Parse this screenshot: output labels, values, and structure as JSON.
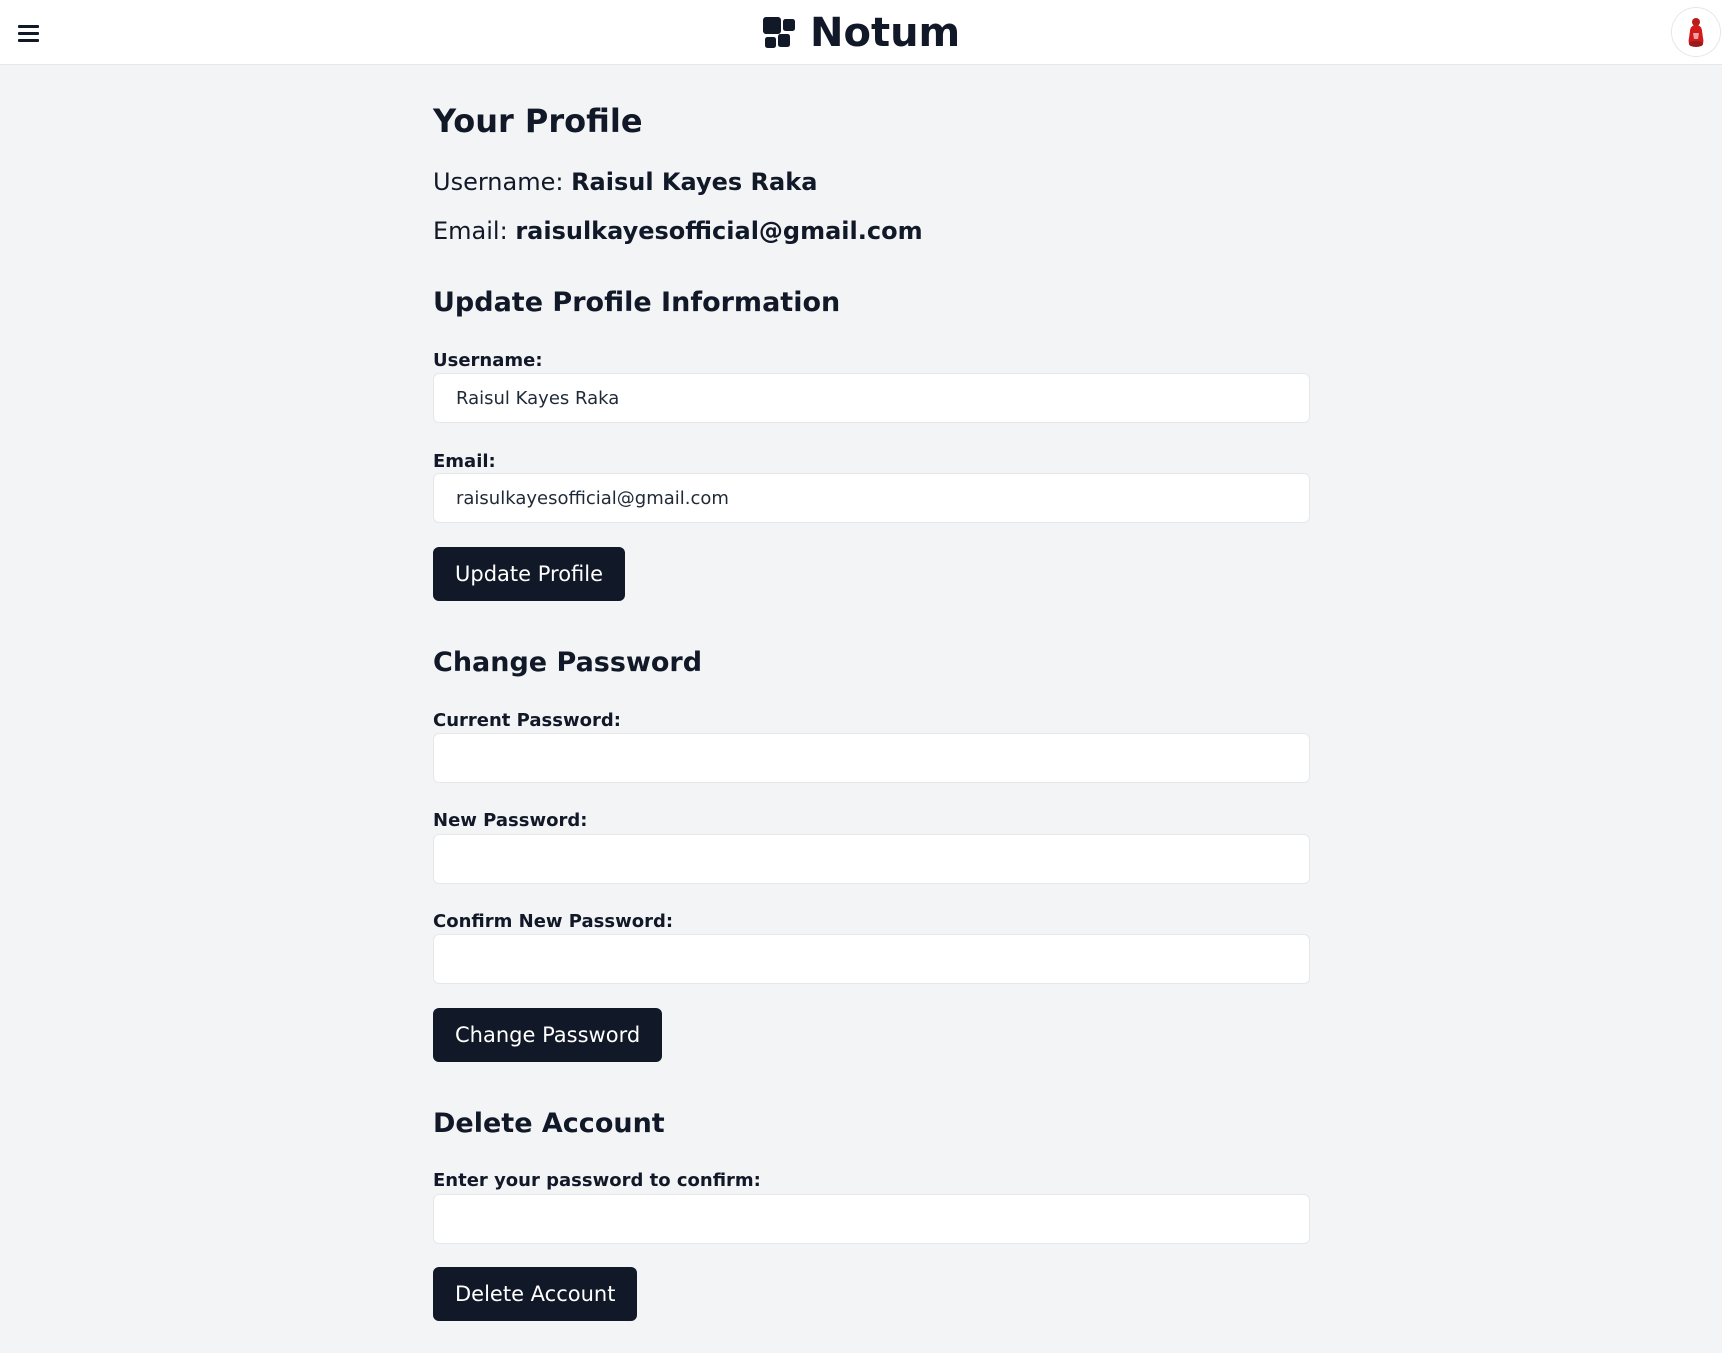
{
  "header": {
    "brand_name": "Notum",
    "menu_icon": "hamburger-menu-icon",
    "logo_icon": "notum-logo-icon",
    "avatar_icon": "user-avatar-icon"
  },
  "profile": {
    "title": "Your Profile",
    "username_label": "Username:",
    "username_value": "Raisul Kayes Raka",
    "email_label": "Email:",
    "email_value": "raisulkayesofficial@gmail.com"
  },
  "update_profile": {
    "title": "Update Profile Information",
    "username_label": "Username:",
    "username_value": "Raisul Kayes Raka",
    "email_label": "Email:",
    "email_value": "raisulkayesofficial@gmail.com",
    "button_label": "Update Profile"
  },
  "change_password": {
    "title": "Change Password",
    "current_label": "Current Password:",
    "new_label": "New Password:",
    "confirm_label": "Confirm New Password:",
    "button_label": "Change Password"
  },
  "delete_account": {
    "title": "Delete Account",
    "password_label": "Enter your password to confirm:",
    "button_label": "Delete Account"
  },
  "colors": {
    "page_background": "#f3f4f6",
    "button_background": "#111827",
    "button_text": "#ffffff",
    "avatar_accent": "#d11a1a"
  }
}
